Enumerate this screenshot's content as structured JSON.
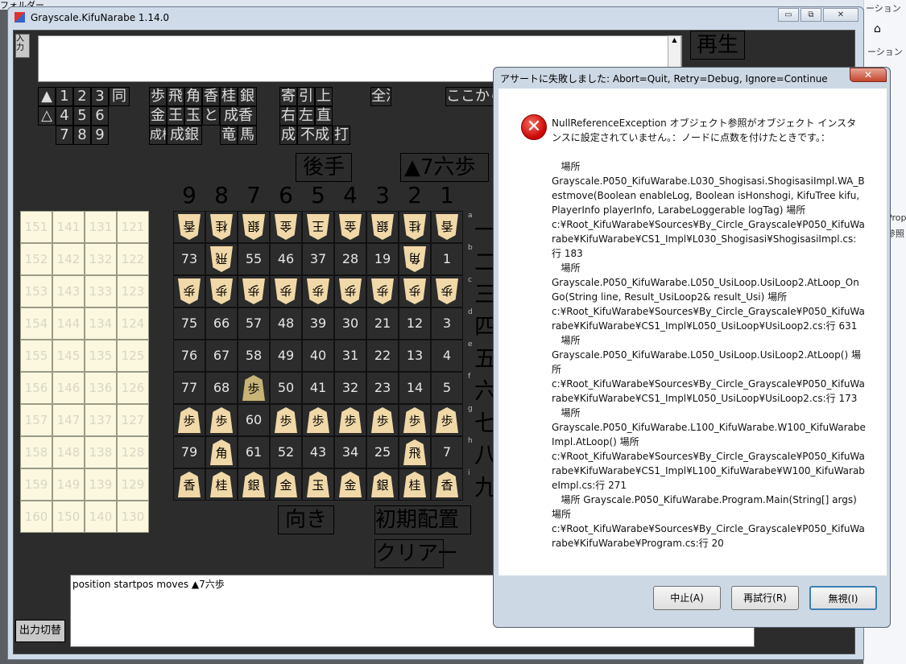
{
  "background": {
    "folder_label": "フォルダー",
    "right_texts": [
      "ーション",
      "ーション",
      "Prop",
      "参照"
    ]
  },
  "window": {
    "title": "Grayscale.KifuNarabe 1.14.0",
    "min_label": "▭",
    "max_label": "⧉",
    "close_label": "✕"
  },
  "input": {
    "label": "入力",
    "value": ""
  },
  "move_buttons": [
    [
      "▲",
      "1",
      "2",
      "3",
      "同"
    ],
    [
      "△",
      "4",
      "5",
      "6"
    ],
    [
      "7",
      "8",
      "9"
    ]
  ],
  "piece_buttons": [
    [
      "歩",
      "飛",
      "角",
      "香",
      "桂",
      "銀"
    ],
    [
      "金",
      "王",
      "玉",
      "と",
      "成香"
    ],
    [
      "成桂",
      "成銀",
      "竜",
      "馬"
    ]
  ],
  "modifier_buttons": [
    [
      "寄",
      "引",
      "上"
    ],
    [
      "右",
      "左",
      "直"
    ],
    [
      "成",
      "不成",
      "打"
    ]
  ],
  "misc_buttons": {
    "all_clear": "全消",
    "from_here": "ここから",
    "play": "再生"
  },
  "turn_label": "後手",
  "last_move": "▲7六歩",
  "columns": [
    "9",
    "8",
    "7",
    "6",
    "5",
    "4",
    "3",
    "2",
    "1"
  ],
  "rows": [
    "一",
    "二",
    "三",
    "四",
    "五",
    "六",
    "七",
    "八",
    "九"
  ],
  "row_marks": [
    "a",
    "b",
    "c",
    "d",
    "e",
    "f",
    "g",
    "h",
    "i"
  ],
  "board": [
    [
      "p:香:g",
      "p:桂:g",
      "p:銀:g",
      "p:金:g",
      "p:王:g",
      "p:金:g",
      "p:銀:g",
      "p:桂:g",
      "p:香:g"
    ],
    [
      "73",
      "p:飛:g",
      "55",
      "46",
      "37",
      "28",
      "19",
      "p:角:g",
      "1"
    ],
    [
      "p:歩:g",
      "p:歩:g",
      "p:歩:g",
      "p:歩:g",
      "p:歩:g",
      "p:歩:g",
      "p:歩:g",
      "p:歩:g",
      "p:歩:g"
    ],
    [
      "75",
      "66",
      "57",
      "48",
      "39",
      "30",
      "21",
      "12",
      "3"
    ],
    [
      "76",
      "67",
      "58",
      "49",
      "40",
      "31",
      "22",
      "13",
      "4"
    ],
    [
      "77",
      "68",
      "p:歩:s",
      "50",
      "41",
      "32",
      "23",
      "14",
      "5"
    ],
    [
      "p:歩",
      "p:歩",
      "60",
      "p:歩",
      "p:歩",
      "p:歩",
      "p:歩",
      "p:歩",
      "p:歩"
    ],
    [
      "79",
      "p:角",
      "61",
      "52",
      "43",
      "34",
      "25",
      "p:飛",
      "7"
    ],
    [
      "p:香",
      "p:桂",
      "p:銀",
      "p:金",
      "p:玉",
      "p:金",
      "p:銀",
      "p:桂",
      "p:香"
    ]
  ],
  "hand_grid": [
    [
      "151",
      "141",
      "131",
      "121"
    ],
    [
      "152",
      "142",
      "132",
      "122"
    ],
    [
      "153",
      "143",
      "133",
      "123"
    ],
    [
      "154",
      "144",
      "134",
      "124"
    ],
    [
      "155",
      "145",
      "135",
      "125"
    ],
    [
      "156",
      "146",
      "136",
      "126"
    ],
    [
      "157",
      "147",
      "137",
      "127"
    ],
    [
      "158",
      "148",
      "138",
      "128"
    ],
    [
      "159",
      "149",
      "139",
      "129"
    ],
    [
      "160",
      "150",
      "140",
      "130"
    ]
  ],
  "bottom_buttons": {
    "orientation": "向き",
    "initial_setup": "初期配置",
    "clear": "クリアー",
    "output_switch": "出力切替"
  },
  "output_text": "position startpos moves ▲7六歩",
  "dialog": {
    "title": "アサートに失敗しました: Abort=Quit, Retry=Debug, Ignore=Continue",
    "close_label": "✕",
    "message": "NullReferenceException オブジェクト参照がオブジェクト インスタンスに設定されていません。：ノードに点数を付けたときです。：",
    "trace": "   場所\nGrayscale.P050_KifuWarabe.L030_Shogisasi.ShogisasiImpl.WA_Bestmove(Boolean enableLog, Boolean isHonshogi, KifuTree kifu, PlayerInfo playerInfo, LarabeLoggerable logTag) 場所\nc:¥Root_KifuWarabe¥Sources¥By_Circle_Grayscale¥P050_KifuWarabe¥KifuWarabe¥CS1_Impl¥L030_Shogisasi¥ShogisasiImpl.cs:行 183\n   場所\nGrayscale.P050_KifuWarabe.L050_UsiLoop.UsiLoop2.AtLoop_OnGo(String line, Result_UsiLoop2& result_Usi) 場所\nc:¥Root_KifuWarabe¥Sources¥By_Circle_Grayscale¥P050_KifuWarabe¥KifuWarabe¥CS1_Impl¥L050_UsiLoop¥UsiLoop2.cs:行 631\n   場所\nGrayscale.P050_KifuWarabe.L050_UsiLoop.UsiLoop2.AtLoop() 場所\nc:¥Root_KifuWarabe¥Sources¥By_Circle_Grayscale¥P050_KifuWarabe¥KifuWarabe¥CS1_Impl¥L050_UsiLoop¥UsiLoop2.cs:行 173\n   場所\nGrayscale.P050_KifuWarabe.L100_KifuWarabe.W100_KifuWarabeImpl.AtLoop() 場所\nc:¥Root_KifuWarabe¥Sources¥By_Circle_Grayscale¥P050_KifuWarabe¥KifuWarabe¥CS1_Impl¥L100_KifuWarabe¥W100_KifuWarabeImpl.cs:行 271\n   場所 Grayscale.P050_KifuWarabe.Program.Main(String[] args) 場所\nc:¥Root_KifuWarabe¥Sources¥By_Circle_Grayscale¥P050_KifuWarabe¥KifuWarabe¥Program.cs:行 20",
    "buttons": {
      "abort": "中止(A)",
      "retry": "再試行(R)",
      "ignore": "無視(I)"
    }
  }
}
